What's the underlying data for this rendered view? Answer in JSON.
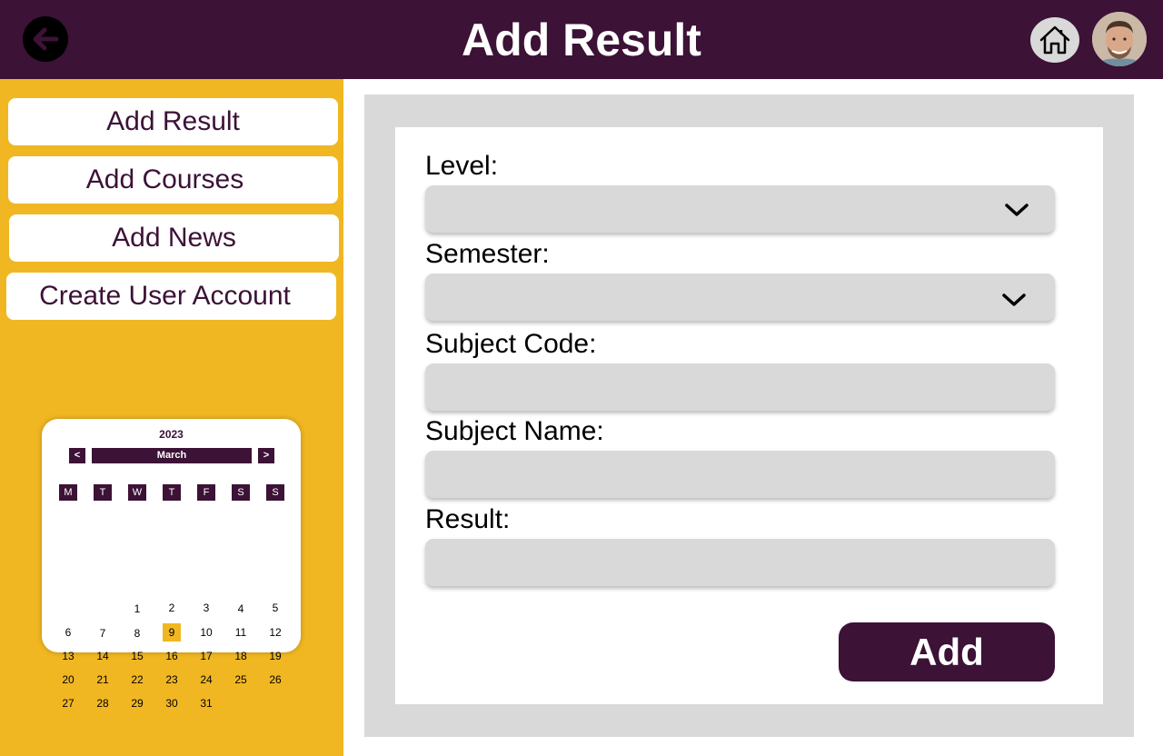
{
  "header": {
    "title": "Add Result",
    "back_icon": "arrow-left-icon",
    "home_icon": "home-icon",
    "colors": {
      "header_bg": "#3c1236",
      "accent": "#f0b722"
    }
  },
  "sidebar": {
    "items": [
      {
        "label": "Add Result"
      },
      {
        "label": "Add Courses"
      },
      {
        "label": "Add News"
      },
      {
        "label": "Create User Account"
      }
    ]
  },
  "calendar": {
    "year": "2023",
    "month": "March",
    "prev": "<",
    "next": ">",
    "weekdays": [
      "M",
      "T",
      "W",
      "T",
      "F",
      "S",
      "S"
    ],
    "selected_day": "9",
    "days": [
      "1",
      "2",
      "3",
      "4",
      "5",
      "6",
      "7",
      "8",
      "9",
      "10",
      "11",
      "12",
      "13",
      "14",
      "15",
      "16",
      "17",
      "18",
      "19",
      "20",
      "21",
      "22",
      "23",
      "24",
      "25",
      "26",
      "27",
      "28",
      "29",
      "30",
      "31"
    ]
  },
  "form": {
    "level": {
      "label": "Level:",
      "value": ""
    },
    "semester": {
      "label": "Semester:",
      "value": ""
    },
    "subject_code": {
      "label": "Subject Code:",
      "value": ""
    },
    "subject_name": {
      "label": "Subject Name:",
      "value": ""
    },
    "result": {
      "label": "Result:",
      "value": ""
    },
    "submit_label": "Add"
  }
}
